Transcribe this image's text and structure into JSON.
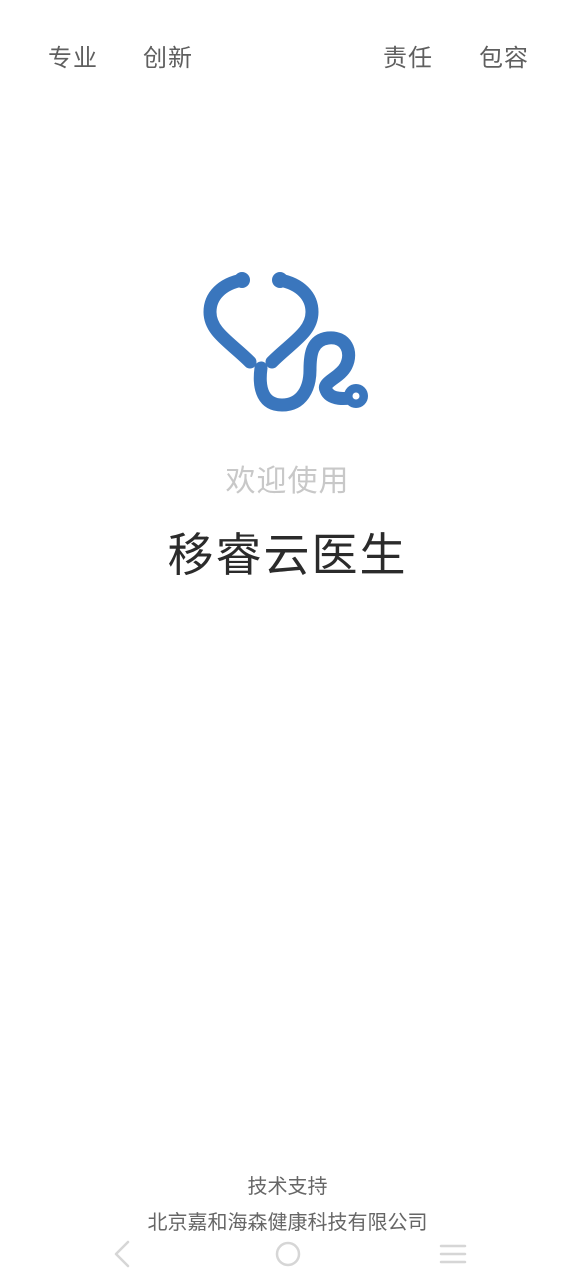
{
  "taglines": [
    "专业",
    "创新",
    "责任",
    "包容"
  ],
  "welcome_text": "欢迎使用",
  "app_name": "移睿云医生",
  "footer": {
    "support_label": "技术支持",
    "company_name": "北京嘉和海森健康科技有限公司"
  },
  "icons": {
    "logo": "stethoscope-icon",
    "back": "back-chevron-icon",
    "home": "home-circle-icon",
    "menu": "menu-lines-icon"
  },
  "colors": {
    "brand": "#3a76bd",
    "welcome_text": "#c8c8c8",
    "app_name": "#2b2b2b",
    "tagline": "#5f5f5f",
    "nav_icon": "#d6d6d6"
  }
}
